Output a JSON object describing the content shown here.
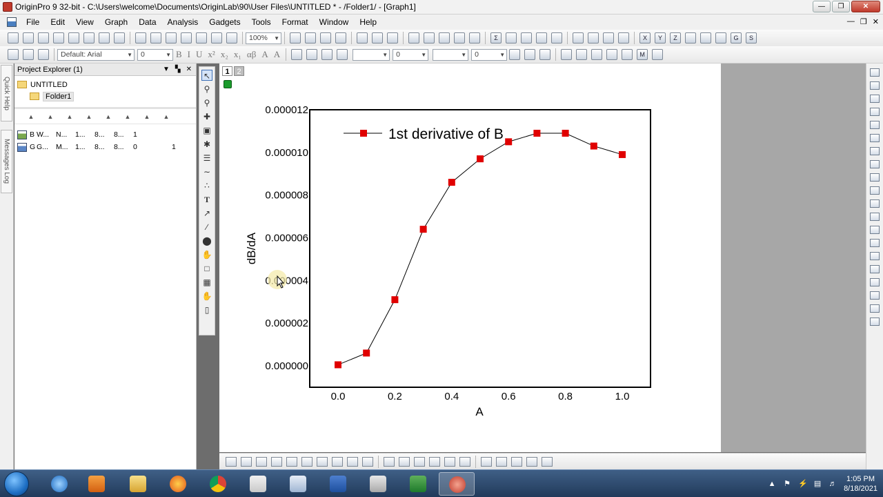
{
  "window": {
    "title": "OriginPro 9 32-bit - C:\\Users\\welcome\\Documents\\OriginLab\\90\\User Files\\UNTITLED * - /Folder1/ - [Graph1]"
  },
  "menu": [
    "File",
    "Edit",
    "View",
    "Graph",
    "Data",
    "Analysis",
    "Gadgets",
    "Tools",
    "Format",
    "Window",
    "Help"
  ],
  "toolbar": {
    "zoom": "100%",
    "font": "Default: Arial",
    "font_size": "0",
    "line_width": "0",
    "fill_value": "0",
    "format_glyphs": [
      "B",
      "I",
      "U",
      "x²",
      "x₂",
      "x₁",
      "αβ",
      "A",
      "A"
    ]
  },
  "side_tabs": {
    "quick_help": "Quick Help",
    "messages_log": "Messages Log"
  },
  "project_explorer": {
    "title": "Project Explorer (1)",
    "root": "UNTITLED",
    "folder": "Folder1",
    "rows": [
      {
        "icon": "workbook-icon",
        "cells": [
          "B",
          "W...",
          "N...",
          "1...",
          "8...",
          "8...",
          "1",
          "",
          ""
        ]
      },
      {
        "icon": "graph-icon",
        "cells": [
          "G",
          "G...",
          "M...",
          "1...",
          "8...",
          "8...",
          "0",
          "",
          "1"
        ]
      }
    ]
  },
  "graph": {
    "layer_tabs": [
      "1",
      "2"
    ],
    "legend_label": "1st derivative of B",
    "colors": {
      "series": "#e00000",
      "line": "#000000",
      "frame": "#000000"
    }
  },
  "chart_data": {
    "type": "line",
    "xlabel": "A",
    "ylabel": "dB/dA",
    "xlim": [
      0.0,
      1.0
    ],
    "ylim": [
      0.0,
      1.2e-05
    ],
    "xticks": [
      "0.0",
      "0.2",
      "0.4",
      "0.6",
      "0.8",
      "1.0"
    ],
    "yticks": [
      "0.000000",
      "0.000002",
      "0.000004",
      "0.000006",
      "0.000008",
      "0.000010",
      "0.000012"
    ],
    "series": [
      {
        "name": "1st derivative of B",
        "marker": "square",
        "x": [
          0.0,
          0.1,
          0.2,
          0.3,
          0.4,
          0.5,
          0.6,
          0.7,
          0.8,
          0.9,
          1.0
        ],
        "y": [
          5e-08,
          6e-07,
          3.1e-06,
          6.4e-06,
          8.6e-06,
          9.7e-06,
          1.05e-05,
          1.09e-05,
          1.09e-05,
          1.03e-05,
          9.9e-06
        ]
      }
    ]
  },
  "taskbar": {
    "time": "1:05 PM",
    "date": "8/18/2021"
  }
}
